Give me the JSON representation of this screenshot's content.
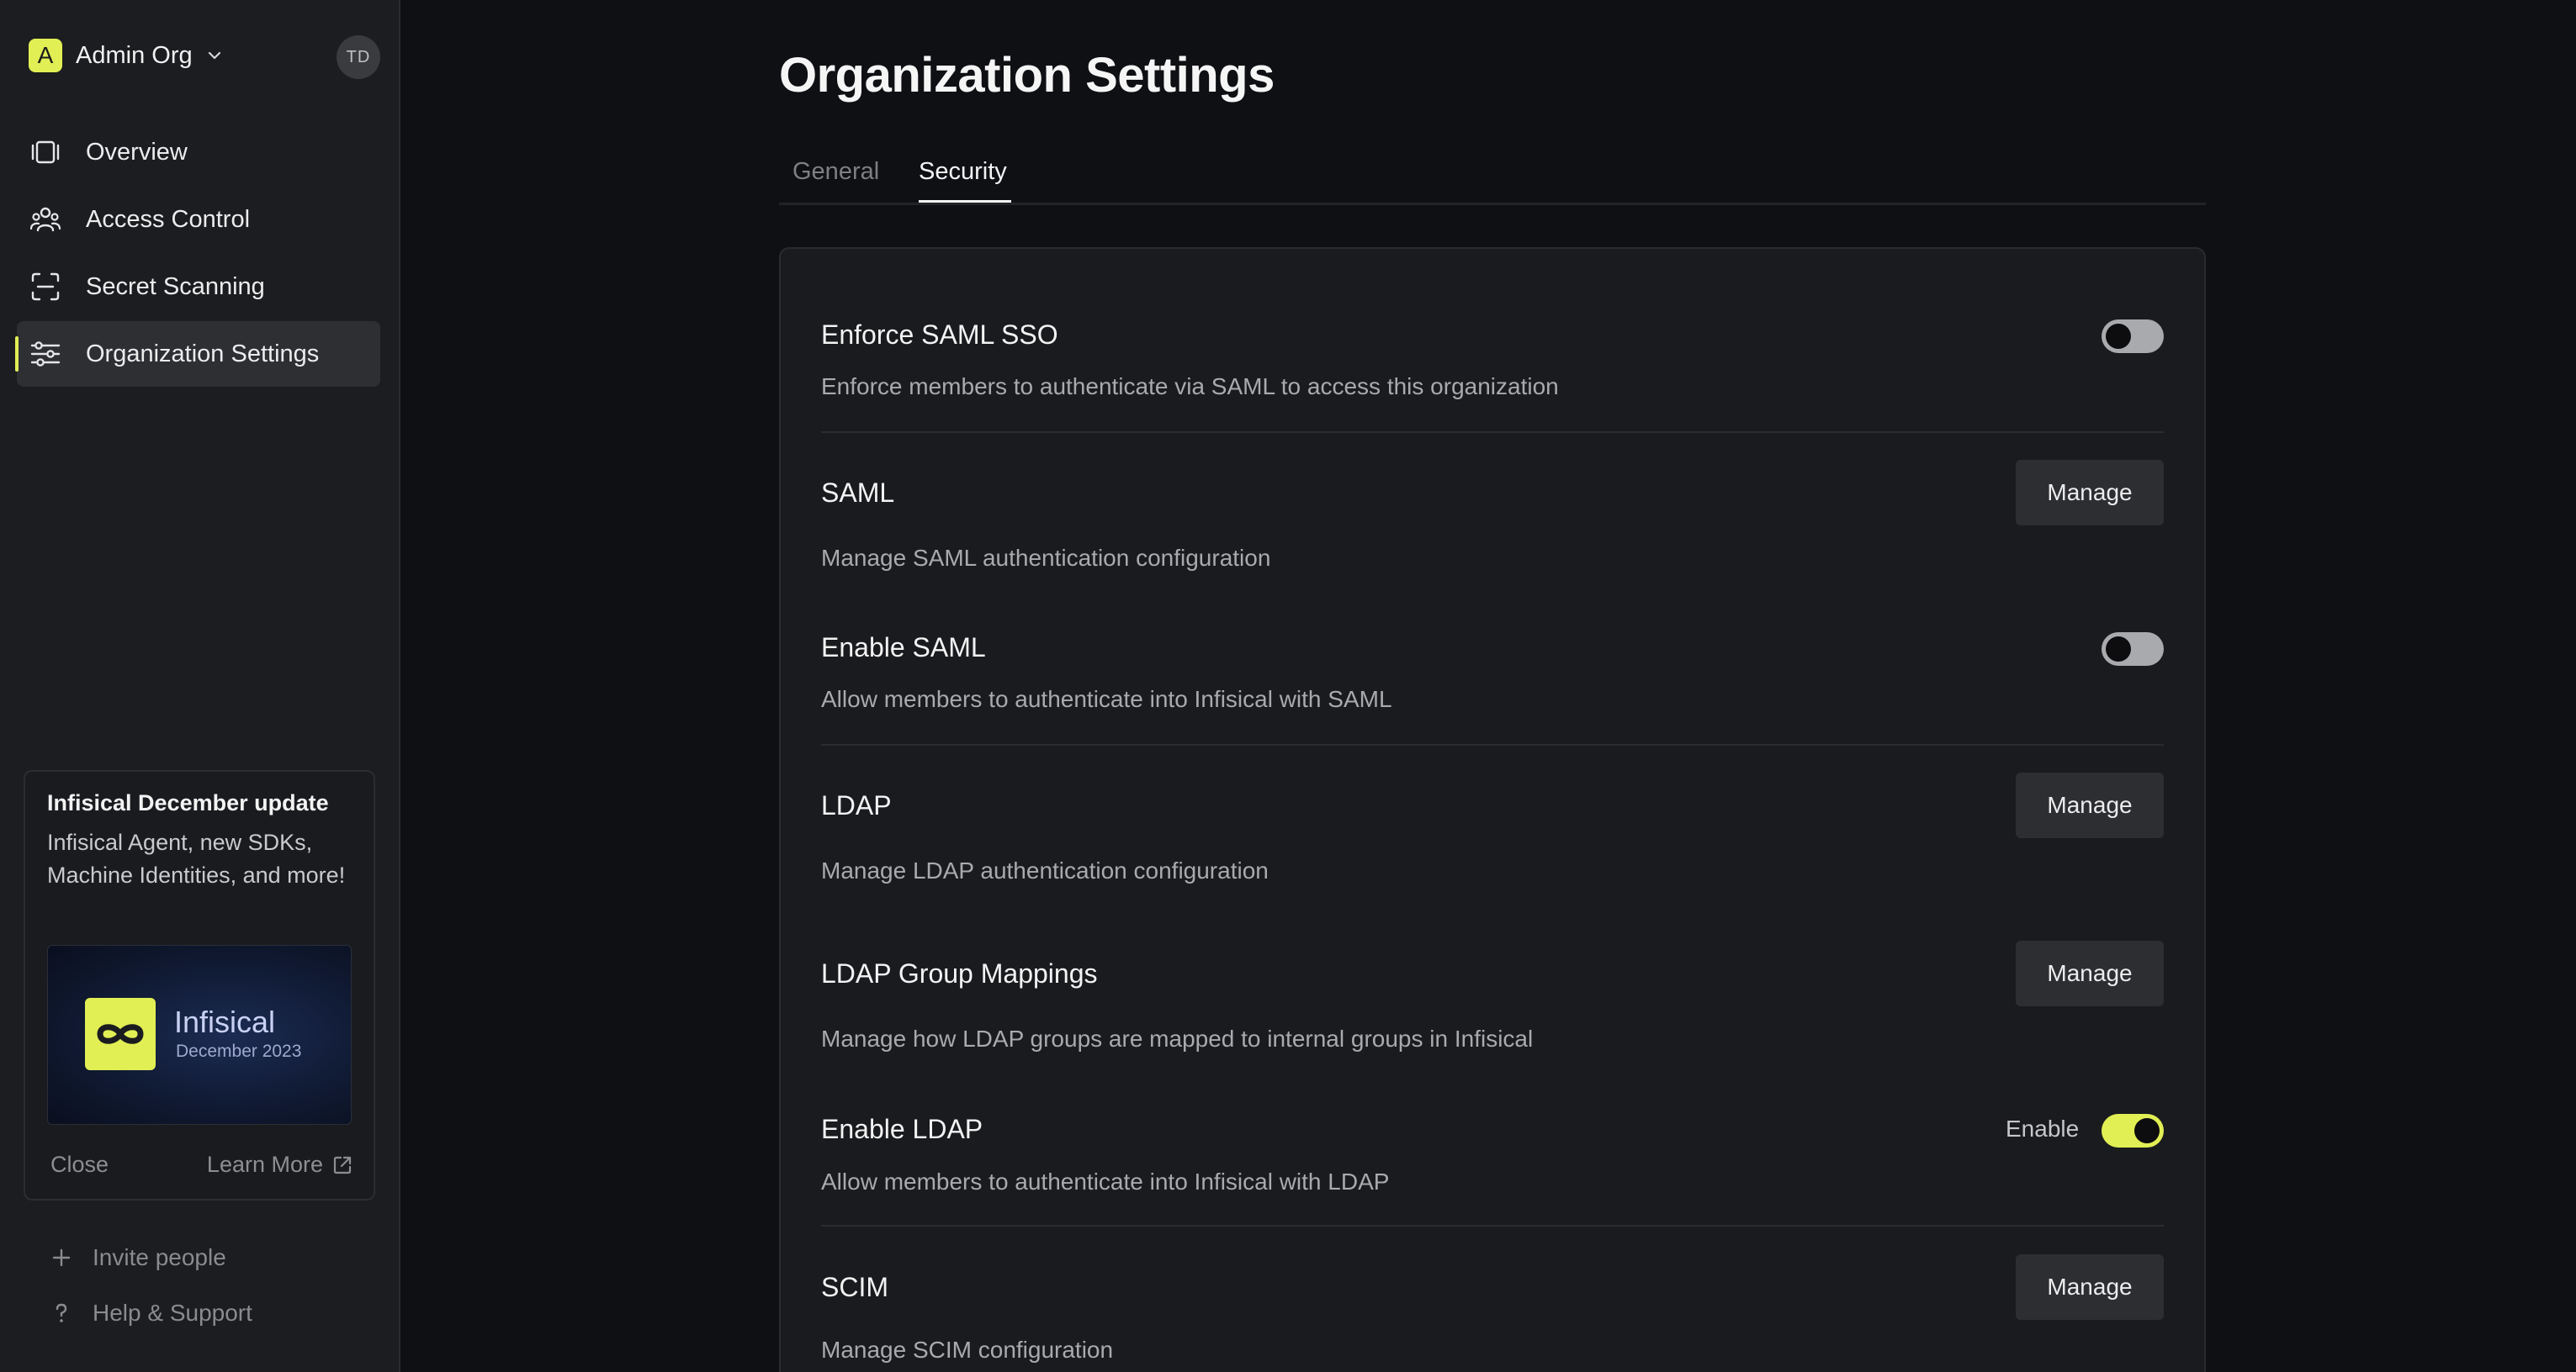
{
  "sidebar": {
    "org": {
      "badge": "A",
      "name": "Admin Org"
    },
    "avatar": "TD",
    "nav": [
      {
        "label": "Overview",
        "icon": "overview-icon"
      },
      {
        "label": "Access Control",
        "icon": "users-icon"
      },
      {
        "label": "Secret Scanning",
        "icon": "scan-icon"
      },
      {
        "label": "Organization Settings",
        "icon": "sliders-icon",
        "active": true
      }
    ],
    "update_card": {
      "title": "Infisical December update",
      "description": "Infisical Agent, new SDKs, Machine Identities, and more!",
      "image_word": "Infisical",
      "image_date": "December 2023",
      "close": "Close",
      "learn_more": "Learn More"
    },
    "invite": "Invite people",
    "help": "Help & Support"
  },
  "main": {
    "title": "Organization Settings",
    "tabs": [
      {
        "label": "General",
        "active": false
      },
      {
        "label": "Security",
        "active": true
      }
    ],
    "rows": [
      {
        "title": "Enforce SAML SSO",
        "desc": "Enforce members to authenticate via SAML to access this organization",
        "control": "toggle",
        "on": false
      },
      {
        "title": "SAML",
        "desc": "Manage SAML authentication configuration",
        "control": "button",
        "button": "Manage"
      },
      {
        "title": "Enable SAML",
        "desc": "Allow members to authenticate into Infisical with SAML",
        "control": "toggle",
        "on": false
      },
      {
        "title": "LDAP",
        "desc": "Manage LDAP authentication configuration",
        "control": "button",
        "button": "Manage"
      },
      {
        "title": "LDAP Group Mappings",
        "desc": "Manage how LDAP groups are mapped to internal groups in Infisical",
        "control": "button",
        "button": "Manage"
      },
      {
        "title": "Enable LDAP",
        "desc": "Allow members to authenticate into Infisical with LDAP",
        "control": "toggle",
        "on": true,
        "toggle_label": "Enable"
      },
      {
        "title": "SCIM",
        "desc": "Manage SCIM configuration",
        "control": "button",
        "button": "Manage"
      }
    ]
  },
  "colors": {
    "accent": "#e1ef54",
    "background": "#0e1013",
    "sidebar": "#1c1d20",
    "panel": "#1a1b1e"
  }
}
